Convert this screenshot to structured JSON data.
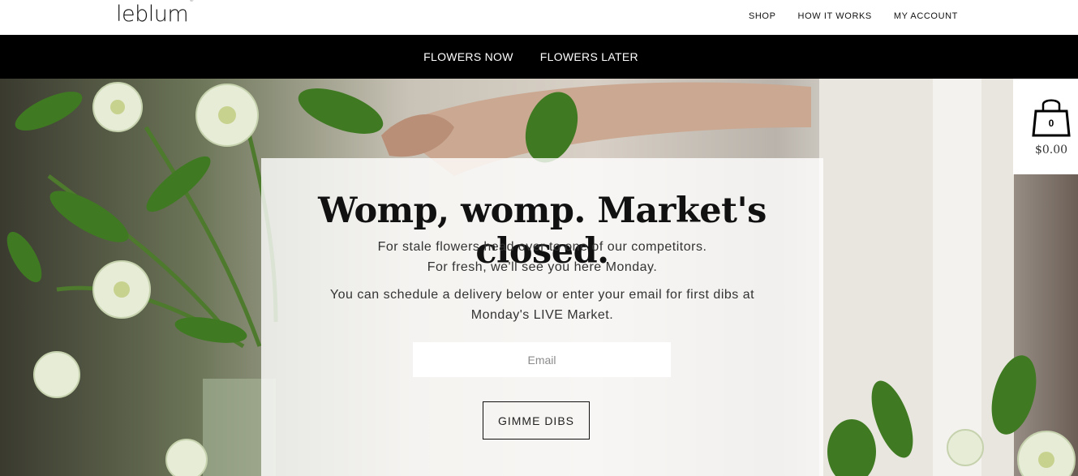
{
  "brand": {
    "logo_text": "leblum",
    "registered": "®"
  },
  "top_nav": {
    "items": [
      {
        "label": "SHOP"
      },
      {
        "label": "HOW IT WORKS"
      },
      {
        "label": "MY ACCOUNT"
      }
    ]
  },
  "sub_nav": {
    "items": [
      {
        "label": "FLOWERS NOW"
      },
      {
        "label": "FLOWERS LATER"
      }
    ]
  },
  "cart": {
    "count": "0",
    "total": "$0.00",
    "icon": "shopping-bag-icon"
  },
  "hero": {
    "headline": "Womp, womp. Market's closed.",
    "line1": "For stale flowers head over to one of our competitors.",
    "line2": "For fresh, we'll see you here Monday.",
    "line3": "You can schedule a delivery below or enter your email for first dibs at",
    "line4": "Monday's LIVE Market.",
    "email_placeholder": "Email",
    "email_value": "",
    "cta_label": "GIMME DIBS"
  },
  "colors": {
    "nav_bar": "#000000",
    "card_overlay": "#ffffffcc",
    "text": "#222222"
  }
}
